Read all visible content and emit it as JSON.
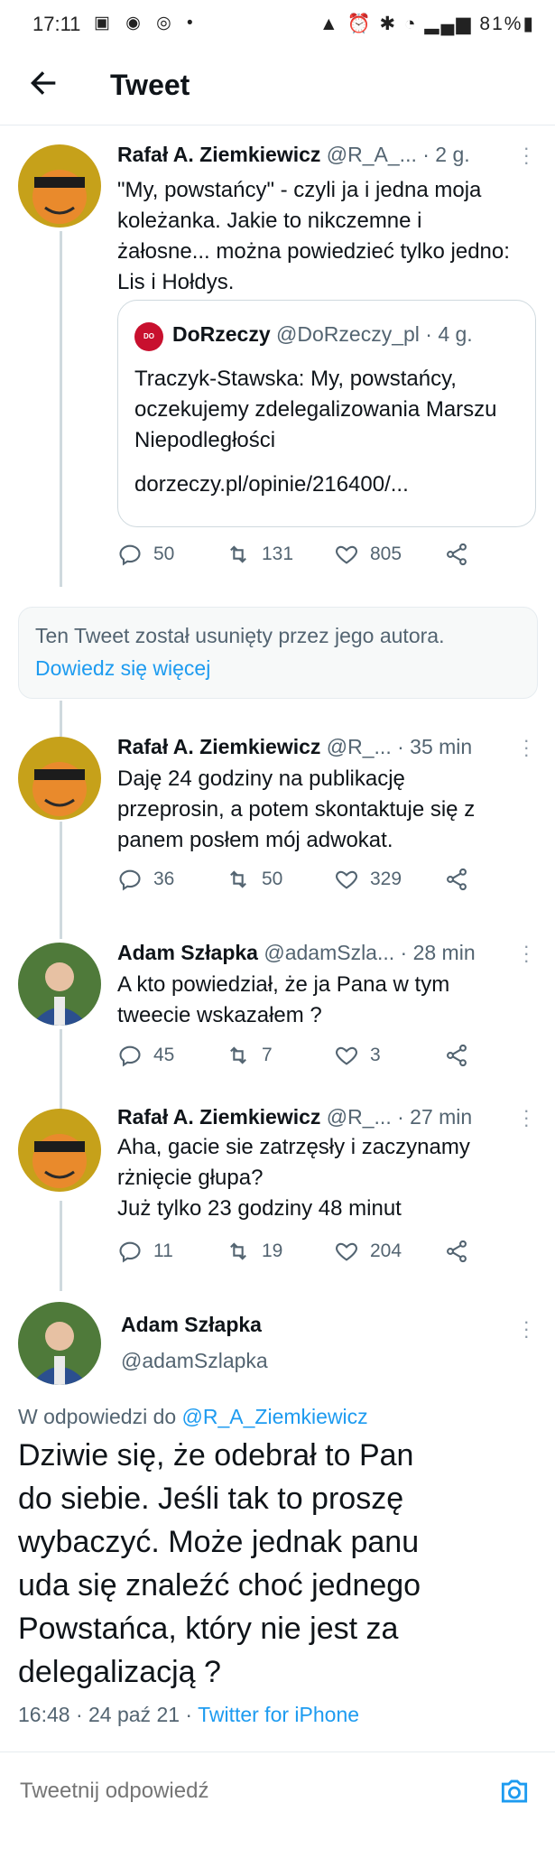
{
  "status_bar": {
    "time": "17:11",
    "battery": "81%"
  },
  "header": {
    "title": "Tweet"
  },
  "tweets": [
    {
      "name": "Rafał A. Ziemkiewicz",
      "handle": "@R_A_...",
      "time": "· 2 g.",
      "text_lines": [
        "\"My, powstańcy\" - czyli ja i jedna moja",
        "koleżanka. Jakie to nikczemne i",
        "żałosne... można powiedzieć tylko jedno:",
        "Lis i Hołdys."
      ],
      "replies": "50",
      "retweets": "131",
      "likes": "805"
    },
    {
      "name": "Rafał A. Ziemkiewicz",
      "handle": "@R_...",
      "time": "· 35 min",
      "text_lines": [
        "Daję 24 godziny na publikację",
        "przeprosin, a potem skontaktuje się z",
        "panem posłem mój adwokat."
      ],
      "replies": "36",
      "retweets": "50",
      "likes": "329"
    },
    {
      "name": "Adam Szłapka",
      "handle": "@adamSzla...",
      "time": "· 28 min",
      "text_lines": [
        "A kto powiedział, że ja Pana w tym",
        "tweecie wskazałem ?"
      ],
      "replies": "45",
      "retweets": "7",
      "likes": "3"
    },
    {
      "name": "Rafał A. Ziemkiewicz",
      "handle": "@R_...",
      "time": "· 27 min",
      "text_lines": [
        "Aha, gacie sie zatrzęsły i zaczynamy",
        "rżnięcie głupa?",
        "Już tylko 23 godziny 48 minut"
      ],
      "replies": "11",
      "retweets": "19",
      "likes": "204"
    }
  ],
  "quote": {
    "logo_text": "DO RZECZY",
    "name": "DoRzeczy",
    "handle": "@DoRzeczy_pl",
    "time": "· 4 g.",
    "text_lines": [
      "Traczyk-Stawska: My, powstańcy,",
      "oczekujemy zdelegalizowania Marszu",
      "Niepodległości"
    ],
    "link": "dorzeczy.pl/opinie/216400/..."
  },
  "deleted": {
    "text": "Ten Tweet został usunięty przez jego autora.",
    "link": "Dowiedz się więcej"
  },
  "main_tweet": {
    "name": "Adam Szłapka",
    "handle": "@adamSzlapka",
    "reply_prefix": "W odpowiedzi do ",
    "reply_to": "@R_A_Ziemkiewicz",
    "text_lines": [
      "Dziwie się, że odebrał to Pan",
      "do siebie. Jeśli tak to proszę",
      "wybaczyć. Może jednak panu",
      "uda się znaleźć choć jednego",
      "Powstańca, który nie jest za",
      "delegalizacją ?"
    ],
    "meta_date": "16:48 · 24 paź 21 · ",
    "meta_source": "Twitter for iPhone"
  },
  "reply_box": {
    "placeholder": "Tweetnij odpowiedź"
  },
  "colors": {
    "accent": "#1d9bf0",
    "muted": "#536471"
  }
}
